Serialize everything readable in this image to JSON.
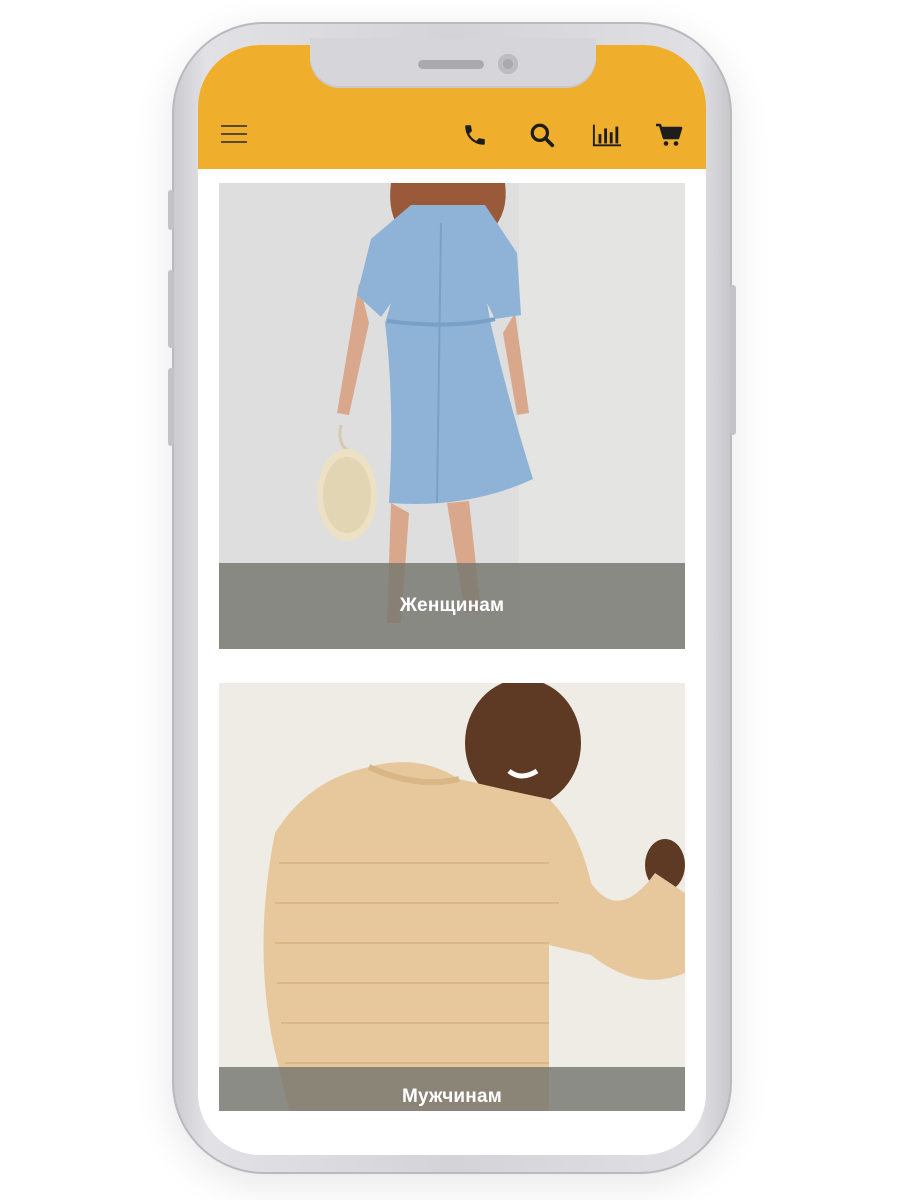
{
  "header": {
    "background_color": "#efae2c",
    "icons": [
      "menu-icon",
      "phone-icon",
      "search-icon",
      "chart-icon",
      "cart-icon"
    ]
  },
  "categories": [
    {
      "label": "Женщинам"
    },
    {
      "label": "Мужчинам"
    }
  ]
}
